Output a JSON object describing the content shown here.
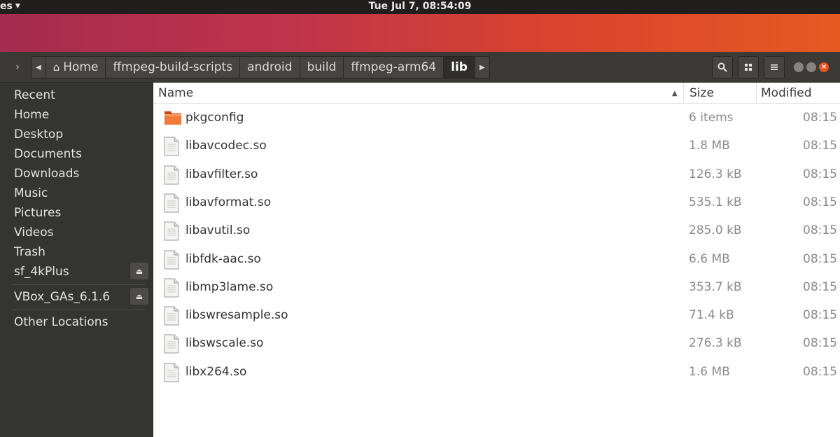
{
  "topbar": {
    "activities_label": "es",
    "clock": "Tue Jul  7, 08:54:09"
  },
  "pathbar": {
    "crumbs": [
      "Home",
      "ffmpeg-build-scripts",
      "android",
      "build",
      "ffmpeg-arm64",
      "lib"
    ]
  },
  "sidebar": {
    "items": [
      "Recent",
      "Home",
      "Desktop",
      "Documents",
      "Downloads",
      "Music",
      "Pictures",
      "Videos",
      "Trash"
    ],
    "devices": [
      "sf_4kPlus",
      "VBox_GAs_6.1.6"
    ],
    "other": "Other Locations"
  },
  "columns": {
    "name": "Name",
    "size": "Size",
    "modified": "Modified"
  },
  "files": [
    {
      "name": "pkgconfig",
      "size": "6 items",
      "modified": "08:15",
      "type": "folder"
    },
    {
      "name": "libavcodec.so",
      "size": "1.8 MB",
      "modified": "08:15",
      "type": "file"
    },
    {
      "name": "libavfilter.so",
      "size": "126.3 kB",
      "modified": "08:15",
      "type": "file"
    },
    {
      "name": "libavformat.so",
      "size": "535.1 kB",
      "modified": "08:15",
      "type": "file"
    },
    {
      "name": "libavutil.so",
      "size": "285.0 kB",
      "modified": "08:15",
      "type": "file"
    },
    {
      "name": "libfdk-aac.so",
      "size": "6.6 MB",
      "modified": "08:15",
      "type": "file"
    },
    {
      "name": "libmp3lame.so",
      "size": "353.7 kB",
      "modified": "08:15",
      "type": "file"
    },
    {
      "name": "libswresample.so",
      "size": "71.4 kB",
      "modified": "08:15",
      "type": "file"
    },
    {
      "name": "libswscale.so",
      "size": "276.3 kB",
      "modified": "08:15",
      "type": "file"
    },
    {
      "name": "libx264.so",
      "size": "1.6 MB",
      "modified": "08:15",
      "type": "file"
    }
  ],
  "colors": {
    "accent": "#e95420",
    "headerbar": "#3b3a36",
    "sidebar": "#343431"
  }
}
